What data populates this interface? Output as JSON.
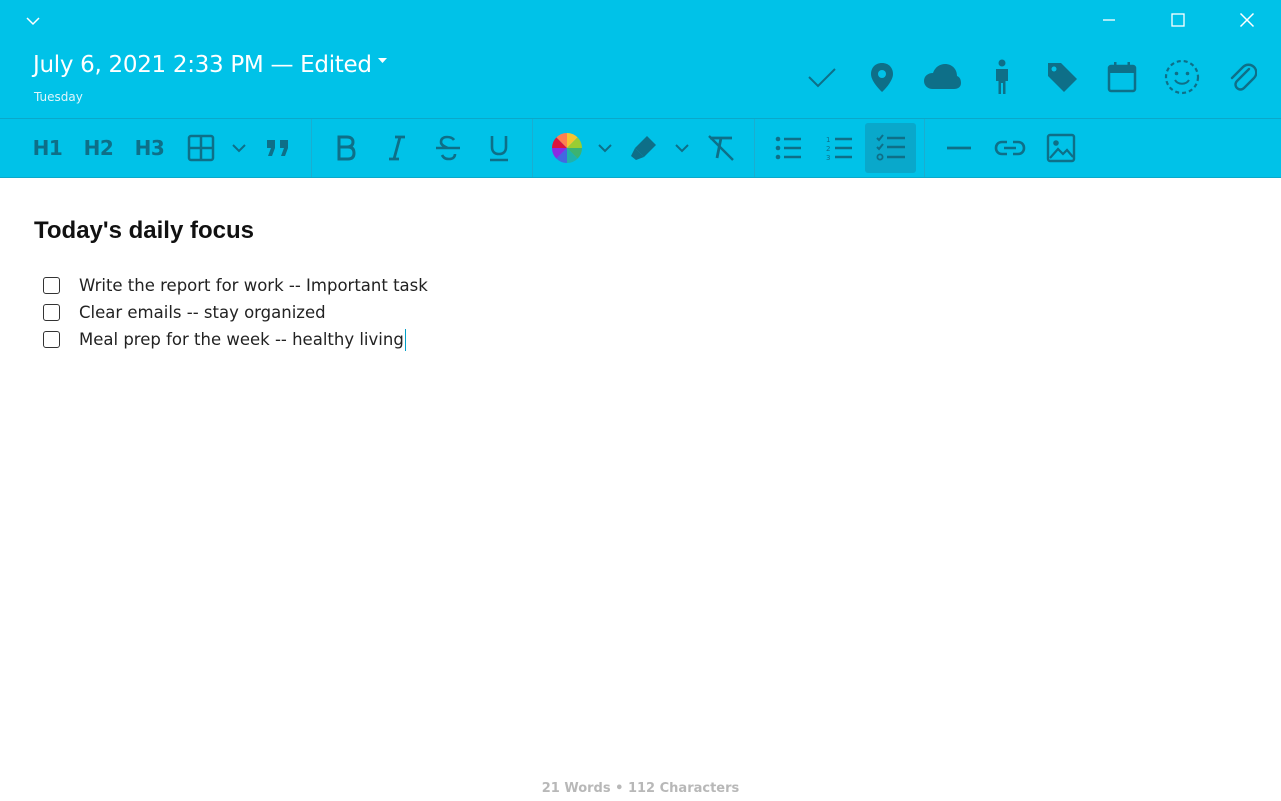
{
  "window": {
    "minimize_icon": "minimize-icon",
    "maximize_icon": "maximize-icon",
    "close_icon": "close-icon"
  },
  "header": {
    "date_title": "July 6, 2021 2:33 PM — Edited",
    "day": "Tuesday",
    "meta_icons": [
      "checkmark-icon",
      "location-pin-icon",
      "cloud-icon",
      "person-icon",
      "tag-icon",
      "calendar-icon",
      "mood-face-icon",
      "paperclip-icon"
    ]
  },
  "toolbar": {
    "h1": "H1",
    "h2": "H2",
    "h3": "H3",
    "active_item": "checklist",
    "colors": {
      "accent": "#00c2e8",
      "icon": "#0e6f88",
      "active_bg": "#09a8cb"
    }
  },
  "document": {
    "title": "Today's daily focus",
    "tasks": [
      {
        "text": "Write the report for work -- Important task",
        "checked": false
      },
      {
        "text": "Clear emails -- stay organized",
        "checked": false
      },
      {
        "text": "Meal prep for the week -- healthy living",
        "checked": false
      }
    ]
  },
  "status": {
    "counts": "21 Words • 112 Characters"
  }
}
